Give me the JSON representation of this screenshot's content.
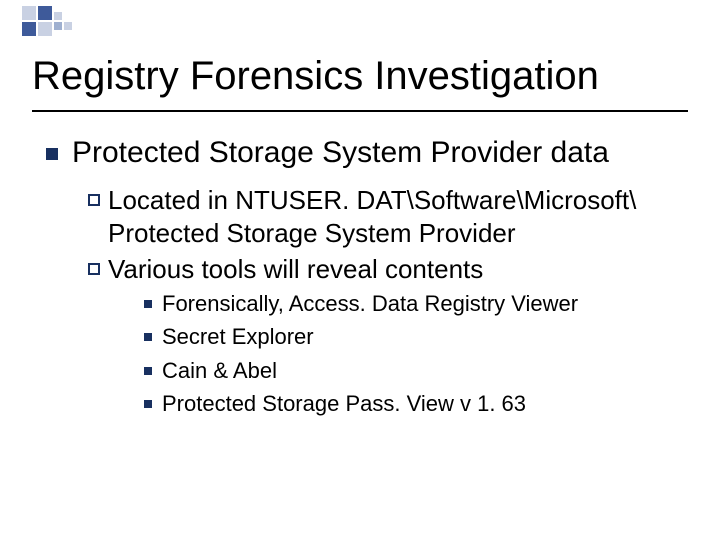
{
  "title": "Registry Forensics Investigation",
  "level1": {
    "text": "Protected Storage System Provider data"
  },
  "level2": [
    {
      "text": "Located in NTUSER. DAT\\Software\\Microsoft\\ Protected Storage System Provider"
    },
    {
      "text": "Various tools will reveal contents"
    }
  ],
  "level3": [
    {
      "text": "Forensically, Access. Data Registry Viewer"
    },
    {
      "text": "Secret Explorer"
    },
    {
      "text": "Cain & Abel"
    },
    {
      "text": "Protected Storage Pass. View v 1. 63"
    }
  ]
}
